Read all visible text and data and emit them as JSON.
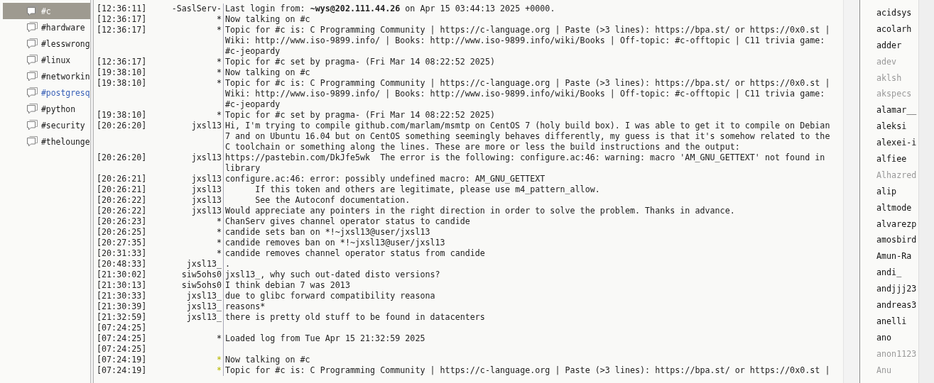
{
  "sidebar": {
    "channels": [
      {
        "name": "#c",
        "selected": true,
        "highlighted": false
      },
      {
        "name": "#hardware",
        "selected": false,
        "highlighted": false
      },
      {
        "name": "#lesswrong",
        "selected": false,
        "highlighted": false
      },
      {
        "name": "#linux",
        "selected": false,
        "highlighted": false
      },
      {
        "name": "#networkin",
        "selected": false,
        "highlighted": false
      },
      {
        "name": "#postgresq",
        "selected": false,
        "highlighted": true
      },
      {
        "name": "#python",
        "selected": false,
        "highlighted": false
      },
      {
        "name": "#security",
        "selected": false,
        "highlighted": false
      },
      {
        "name": "#thelounge",
        "selected": false,
        "highlighted": false
      }
    ]
  },
  "log": {
    "rows": [
      {
        "time": "[12:36:11]",
        "nick": "-SaslServ-",
        "text": "Last login from: **~wys@202.111.44.26** on Apr 15 03:44:13 2025 +0000.",
        "unseen": false
      },
      {
        "time": "[12:36:17]",
        "nick": "*",
        "text": "Now talking on #c",
        "unseen": false
      },
      {
        "time": "[12:36:17]",
        "nick": "*",
        "text": "Topic for #c is: C Programming Community | https://c-language.org | Paste (>3 lines): https://bpa.st/ or https://0x0.st | Wiki: http://www.iso-9899.info/ | Books: http://www.iso-9899.info/wiki/Books | Off-topic: #c-offtopic | C11 trivia game: #c-jeopardy",
        "unseen": false
      },
      {
        "time": "[12:36:17]",
        "nick": "*",
        "text": "Topic for #c set by pragma- (Fri Mar 14 08:22:52 2025)",
        "unseen": false
      },
      {
        "time": "[19:38:10]",
        "nick": "*",
        "text": "Now talking on #c",
        "unseen": false
      },
      {
        "time": "[19:38:10]",
        "nick": "*",
        "text": "Topic for #c is: C Programming Community | https://c-language.org | Paste (>3 lines): https://bpa.st/ or https://0x0.st | Wiki: http://www.iso-9899.info/ | Books: http://www.iso-9899.info/wiki/Books | Off-topic: #c-offtopic | C11 trivia game: #c-jeopardy",
        "unseen": false
      },
      {
        "time": "[19:38:10]",
        "nick": "*",
        "text": "Topic for #c set by pragma- (Fri Mar 14 08:22:52 2025)",
        "unseen": false
      },
      {
        "time": "[20:26:20]",
        "nick": "jxsl13",
        "text": "Hi, I'm trying to compile github.com/marlam/msmtp on CentOS 7 (holy build box). I was able to get it to compile on Debian 7 and on Ubuntu 16.04 but on CentOS something seemingly behaves differently, my guess is that it's somehow related to the C toolchain or something along the lines. These are more or less the build instructions and the output:",
        "unseen": false
      },
      {
        "time": "[20:26:20]",
        "nick": "jxsl13",
        "text": "https://pastebin.com/DkJfe5wk  The error is the following: configure.ac:46: warning: macro 'AM_GNU_GETTEXT' not found in library",
        "unseen": false
      },
      {
        "time": "[20:26:21]",
        "nick": "jxsl13",
        "text": "configure.ac:46: error: possibly undefined macro: AM_GNU_GETTEXT",
        "unseen": false
      },
      {
        "time": "[20:26:21]",
        "nick": "jxsl13",
        "text": "      If this token and others are legitimate, please use m4_pattern_allow.",
        "unseen": false
      },
      {
        "time": "[20:26:22]",
        "nick": "jxsl13",
        "text": "      See the Autoconf documentation.",
        "unseen": false
      },
      {
        "time": "[20:26:22]",
        "nick": "jxsl13",
        "text": "Would appreciate any pointers in the right direction in order to solve the problem. Thanks in advance.",
        "unseen": false
      },
      {
        "time": "[20:26:23]",
        "nick": "*",
        "text": "ChanServ gives channel operator status to candide",
        "unseen": false
      },
      {
        "time": "[20:26:25]",
        "nick": "*",
        "text": "candide sets ban on *!~jxsl13@user/jxsl13",
        "unseen": false
      },
      {
        "time": "[20:27:35]",
        "nick": "*",
        "text": "candide removes ban on *!~jxsl13@user/jxsl13",
        "unseen": false
      },
      {
        "time": "[20:31:33]",
        "nick": "*",
        "text": "candide removes channel operator status from candide",
        "unseen": false
      },
      {
        "time": "[20:48:33]",
        "nick": "jxsl13_",
        "text": ".",
        "unseen": false
      },
      {
        "time": "[21:30:02]",
        "nick": "siw5ohs0",
        "text": "jxsl13_, why such out-dated disto versions?",
        "unseen": false
      },
      {
        "time": "[21:30:13]",
        "nick": "siw5ohs0",
        "text": "I think debian 7 was 2013",
        "unseen": false
      },
      {
        "time": "[21:30:33]",
        "nick": "jxsl13_",
        "text": "due to glibc forward compatibility reasona",
        "unseen": false
      },
      {
        "time": "[21:30:39]",
        "nick": "jxsl13_",
        "text": "reasons*",
        "unseen": false
      },
      {
        "time": "[21:32:59]",
        "nick": "jxsl13_",
        "text": "there is pretty old stuff to be found in datacenters",
        "unseen": false
      },
      {
        "time": "[07:24:25]"
      },
      {
        "time": "[07:24:25]",
        "nick": "*",
        "text": "Loaded log from Tue Apr 15 21:32:59 2025",
        "unseen": false
      },
      {
        "time": "[07:24:25]"
      },
      {
        "time": "[07:24:19]",
        "nick": "*",
        "text": "Now talking on #c",
        "unseen": true
      },
      {
        "time": "[07:24:19]",
        "nick": "*",
        "text": "Topic for #c is: C Programming Community | https://c-language.org | Paste (>3 lines): https://bpa.st/ or https://0x0.st |",
        "unseen": true
      }
    ]
  },
  "userlist": {
    "users": [
      {
        "name": "acidsys",
        "away": false
      },
      {
        "name": "acolarh",
        "away": false
      },
      {
        "name": "adder",
        "away": false
      },
      {
        "name": "adev",
        "away": true
      },
      {
        "name": "aklsh",
        "away": true
      },
      {
        "name": "akspecs",
        "away": true
      },
      {
        "name": "alamar__",
        "away": false
      },
      {
        "name": "aleksi",
        "away": false
      },
      {
        "name": "alexei-i",
        "away": false
      },
      {
        "name": "alfiee",
        "away": false
      },
      {
        "name": "Alhazred",
        "away": true
      },
      {
        "name": "alip",
        "away": false
      },
      {
        "name": "altmode",
        "away": false
      },
      {
        "name": "alvarezp",
        "away": false
      },
      {
        "name": "amosbird",
        "away": false
      },
      {
        "name": "Amun-Ra",
        "away": false
      },
      {
        "name": "andi_",
        "away": false
      },
      {
        "name": "andjjj23",
        "away": false
      },
      {
        "name": "andreas3",
        "away": false
      },
      {
        "name": "anelli",
        "away": false
      },
      {
        "name": "ano",
        "away": false
      },
      {
        "name": "anon1123",
        "away": true
      },
      {
        "name": "Anu",
        "away": true
      }
    ]
  }
}
